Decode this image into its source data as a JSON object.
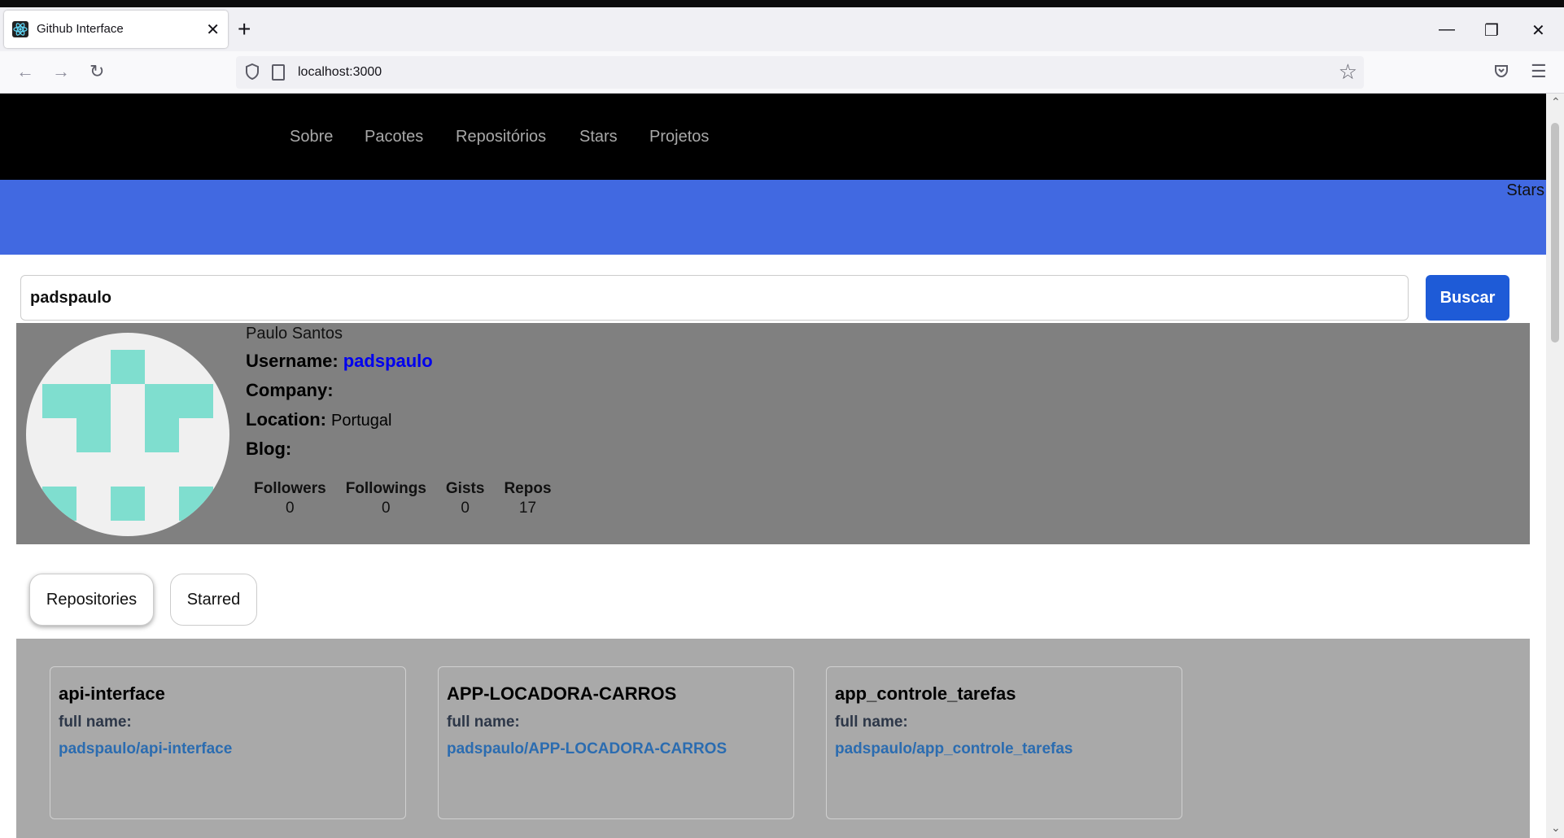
{
  "browser": {
    "tab_title": "Github Interface",
    "tab_close": "✕",
    "new_tab": "+",
    "url": "localhost:3000",
    "controls": {
      "minimize": "—",
      "restore": "❐",
      "close": "✕"
    }
  },
  "site_nav": {
    "items": [
      "Sobre",
      "Pacotes",
      "Repositórios",
      "Stars",
      "Projetos"
    ]
  },
  "banner": {
    "label": "Stars"
  },
  "search": {
    "value": "padspaulo",
    "button_label": "Buscar"
  },
  "profile": {
    "name": "Paulo Santos",
    "username_label": "Username:",
    "username": "padspaulo",
    "company_label": "Company:",
    "company": "",
    "location_label": "Location:",
    "location": "Portugal",
    "blog_label": "Blog:",
    "blog": "",
    "stats": [
      {
        "label": "Followers",
        "value": "0"
      },
      {
        "label": "Followings",
        "value": "0"
      },
      {
        "label": "Gists",
        "value": "0"
      },
      {
        "label": "Repos",
        "value": "17"
      }
    ]
  },
  "tabs": {
    "repositories": "Repositories",
    "starred": "Starred",
    "active": "repositories"
  },
  "repos": [
    {
      "name": "api-interface",
      "full_name_label": "full name:",
      "full_name": "padspaulo/api-interface"
    },
    {
      "name": "APP-LOCADORA-CARROS",
      "full_name_label": "full name:",
      "full_name": "padspaulo/APP-LOCADORA-CARROS"
    },
    {
      "name": "app_controle_tarefas",
      "full_name_label": "full name:",
      "full_name": "padspaulo/app_controle_tarefas"
    }
  ],
  "colors": {
    "nav_bg": "#000000",
    "banner_bg": "#4169e1",
    "profile_bg": "#808080",
    "repos_bg": "#a9a9a9",
    "button_bg": "#1e5bd7",
    "avatar_accent": "#7fdecf",
    "link": "#2b6cb0"
  }
}
